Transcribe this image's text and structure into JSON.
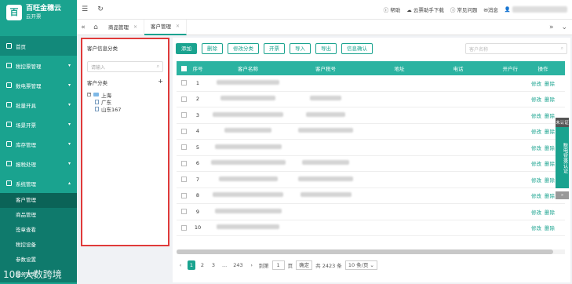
{
  "brand": {
    "logo": "百",
    "name": "百旺金穗云",
    "sub": "云开票"
  },
  "menu": [
    {
      "label": "首页",
      "icon": "home-icon",
      "home": true
    },
    {
      "label": "税控票管理",
      "icon": "invoice-icon"
    },
    {
      "label": "数电票管理",
      "icon": "digital-invoice-icon"
    },
    {
      "label": "批量开具",
      "icon": "batch-icon"
    },
    {
      "label": "场景开票",
      "icon": "scene-icon"
    },
    {
      "label": "库存管理",
      "icon": "stock-icon"
    },
    {
      "label": "报税处理",
      "icon": "tax-icon"
    },
    {
      "label": "系统管理",
      "icon": "system-icon",
      "expanded": true
    }
  ],
  "submenu": [
    "客户管理",
    "商品管理",
    "签章查看",
    "税控设备",
    "参数设置",
    "服务咨询"
  ],
  "topbar": {
    "help": "帮助",
    "download": "云票助手下载",
    "faq": "常见问题",
    "messages": "消息",
    "user": ""
  },
  "tabs": [
    {
      "label": "商品管理",
      "active": false
    },
    {
      "label": "客户管理",
      "active": true
    }
  ],
  "leftpanel": {
    "title": "客户信息分类",
    "search_placeholder": "请输入",
    "category_label": "客户分类",
    "tree_root": "上海",
    "tree_children": [
      "广东",
      "山东167"
    ]
  },
  "toolbar": {
    "buttons": [
      "添加",
      "删除",
      "修改分类",
      "开票",
      "导入",
      "导出",
      "信息确认"
    ],
    "search_placeholder": "客户名称"
  },
  "table": {
    "headers": [
      "序号",
      "客户名称",
      "客户税号",
      "地址",
      "电话",
      "开户行",
      "操作"
    ],
    "rows": [
      {
        "no": "1",
        "edit": "修改",
        "del": "删除"
      },
      {
        "no": "2",
        "edit": "修改",
        "del": "删除"
      },
      {
        "no": "3",
        "edit": "修改",
        "del": "删除"
      },
      {
        "no": "4",
        "edit": "修改",
        "del": "删除"
      },
      {
        "no": "5",
        "edit": "修改",
        "del": "删除"
      },
      {
        "no": "6",
        "edit": "修改",
        "del": "删除"
      },
      {
        "no": "7",
        "edit": "修改",
        "del": "删除"
      },
      {
        "no": "8",
        "edit": "修改",
        "del": "删除"
      },
      {
        "no": "9",
        "edit": "修改",
        "del": "删除"
      },
      {
        "no": "10",
        "edit": "修改",
        "del": "删除"
      }
    ]
  },
  "pager": {
    "prev": "‹",
    "pages": [
      "1",
      "2",
      "3",
      "...",
      "243"
    ],
    "next": "›",
    "goto_label": "到第",
    "goto_value": "1",
    "page_unit": "页",
    "confirm": "确定",
    "total": "共 2423 条",
    "page_size": "10 条/页"
  },
  "float_cert": {
    "tag": "未认证",
    "body": "数电登录认证",
    "more": "»"
  },
  "watermark": "100 大数跨境",
  "colors": {
    "accent": "#1aa38f",
    "highlight_border": "#e03a3a"
  }
}
